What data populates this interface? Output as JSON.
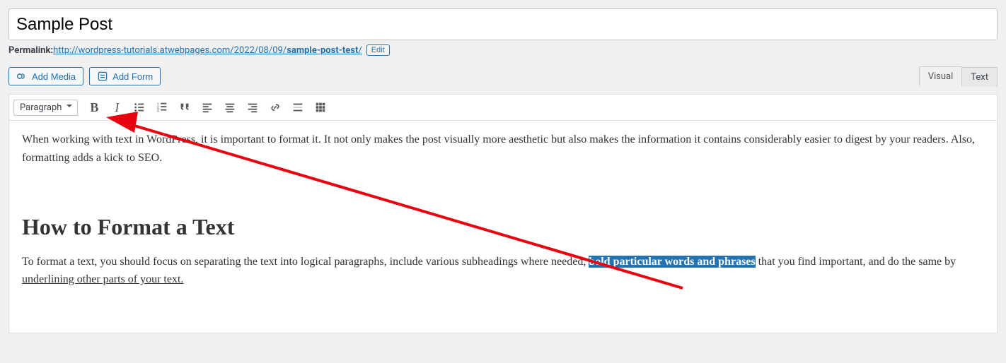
{
  "post": {
    "title": "Sample Post"
  },
  "permalink": {
    "label": "Permalink: ",
    "url_base": "http://wordpress-tutorials.atwebpages.com/2022/08/09/",
    "slug": "sample-post-test",
    "trail": "/",
    "edit_label": "Edit"
  },
  "buttons": {
    "add_media": "Add Media",
    "add_form": "Add Form"
  },
  "tabs": {
    "visual": "Visual",
    "text": "Text"
  },
  "toolbar": {
    "format_select": "Paragraph"
  },
  "content": {
    "p1": "When working with text in WordPress, it is important to format it. It not only makes the post visually more aesthetic but also makes the information it contains considerably easier to digest by your readers. Also, formatting adds a kick to SEO.",
    "h2": "How to Format a Text",
    "p2a": "To format a text, you should focus on separating the text into logical paragraphs, include various subheadings where needed, ",
    "p2_sel": "bold particular words and phrases",
    "p2b": " that you find important, and do the same by ",
    "p2_u": "underlining other parts of your text.",
    "p2c": ""
  }
}
